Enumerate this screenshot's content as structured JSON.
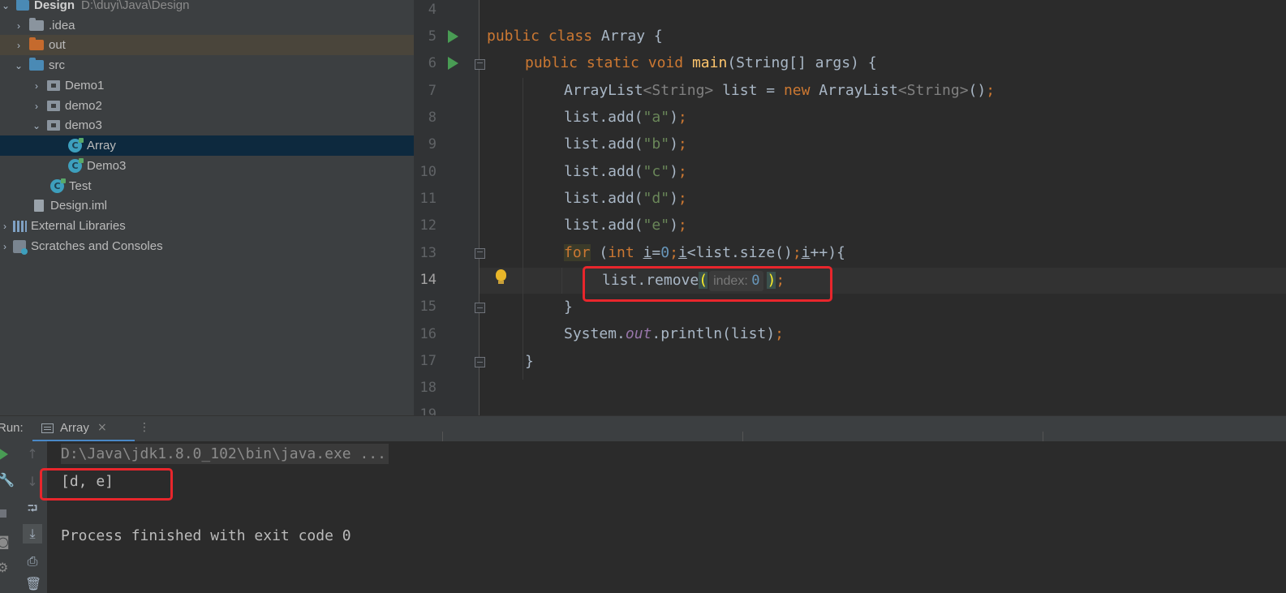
{
  "project_tree": {
    "root": {
      "name": "Design",
      "path": "D:\\duyi\\Java\\Design"
    },
    "items": [
      {
        "label": ".idea",
        "icon": "folder-icon"
      },
      {
        "label": "out",
        "icon": "folder-orange-icon"
      },
      {
        "label": "src",
        "icon": "source-folder-icon"
      },
      {
        "label": "Demo1",
        "icon": "package-icon"
      },
      {
        "label": "demo2",
        "icon": "package-icon"
      },
      {
        "label": "demo3",
        "icon": "package-icon"
      },
      {
        "label": "Array",
        "icon": "java-class-icon"
      },
      {
        "label": "Demo3",
        "icon": "java-class-icon"
      },
      {
        "label": "Test",
        "icon": "java-class-icon"
      },
      {
        "label": "Design.iml",
        "icon": "iml-file-icon"
      },
      {
        "label": "External Libraries",
        "icon": "libraries-icon"
      },
      {
        "label": "Scratches and Consoles",
        "icon": "scratches-icon"
      }
    ],
    "selected": "Array"
  },
  "editor": {
    "line_numbers": [
      "4",
      "5",
      "6",
      "7",
      "8",
      "9",
      "10",
      "11",
      "12",
      "13",
      "14",
      "15",
      "16",
      "17",
      "18"
    ],
    "current_line": "14",
    "lines": {
      "l5": {
        "kw1": "public",
        "kw2": "class",
        "name": "Array",
        "brace": " {"
      },
      "l6": {
        "kw1": "public",
        "kw2": "static",
        "kw3": "void",
        "fn": "main",
        "rest": "(String[] args) {"
      },
      "l7": {
        "t1": "ArrayList",
        "g1": "<String>",
        "t2": " list = ",
        "kw": "new",
        "t3": " ArrayList",
        "g2": "<String>",
        "t4": "()",
        "semi": ";"
      },
      "l8": {
        "call": "list.add(",
        "arg": "\"a\"",
        "close": ")",
        "semi": ";"
      },
      "l9": {
        "call": "list.add(",
        "arg": "\"b\"",
        "close": ")",
        "semi": ";"
      },
      "l10": {
        "call": "list.add(",
        "arg": "\"c\"",
        "close": ")",
        "semi": ";"
      },
      "l11": {
        "call": "list.add(",
        "arg": "\"d\"",
        "close": ")",
        "semi": ";"
      },
      "l12": {
        "call": "list.add(",
        "arg": "\"e\"",
        "close": ")",
        "semi": ";"
      },
      "l13": {
        "kw": "for",
        "p1": " (",
        "kw2": "int",
        "sp": " ",
        "i1": "i",
        "eq": "=",
        "n0": "0",
        "s1": ";",
        "i2": "i",
        "lt": "<list.size()",
        "s2": ";",
        "i3": "i",
        "tail": "++){"
      },
      "l14": {
        "call": "list.remove",
        "open": "(",
        "hint_label": "index:",
        "hint_value": "0",
        "close": ")",
        "semi": ";"
      },
      "l15": {
        "text": "}"
      },
      "l16": {
        "t1": "System.",
        "field": "out",
        "t2": ".println(list)",
        "semi": ";"
      },
      "l17": {
        "text": "}"
      }
    }
  },
  "run_panel": {
    "label": "Run:",
    "tab": {
      "name": "Array",
      "close": "×",
      "more": "⋮"
    },
    "output": {
      "command": "D:\\Java\\jdk1.8.0_102\\bin\\java.exe ...",
      "result": "[d, e]",
      "exit": "Process finished with exit code 0"
    },
    "tools": [
      "rerun-icon",
      "up-arrow-icon",
      "down-arrow-icon",
      "wrench-icon",
      "soft-wrap-icon",
      "stop-icon",
      "scroll-to-end-icon",
      "camera-icon",
      "print-icon",
      "settings-icon",
      "trash-icon"
    ]
  },
  "colors": {
    "highlight_box": "#e8262c",
    "selection": "#0d293e",
    "run_arrow": "#499c54"
  }
}
